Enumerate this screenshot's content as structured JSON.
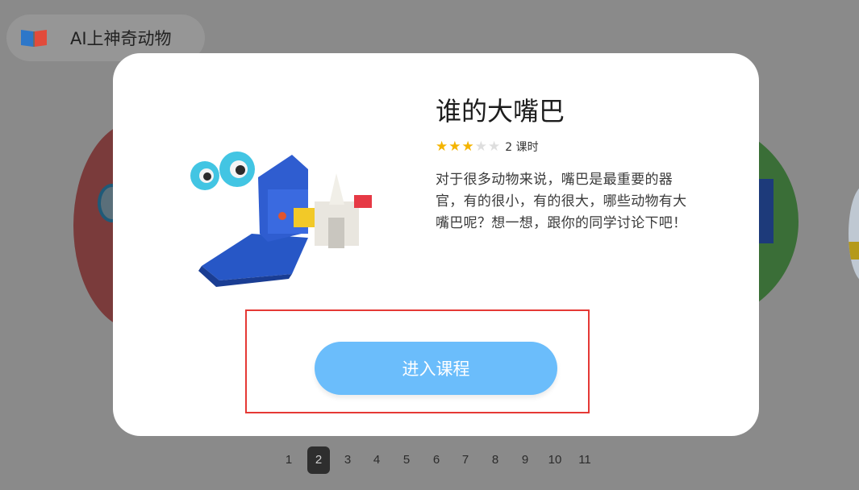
{
  "header": {
    "title": "AI上神奇动物",
    "icon": "open-book-icon"
  },
  "modal": {
    "title": "谁的大嘴巴",
    "rating": {
      "filled": 3,
      "total": 5,
      "star_color": "#f4b400",
      "empty_color": "#dedede"
    },
    "lesson_count": "2 课时",
    "description": "对于很多动物来说，嘴巴是最重要的器官，有的很小，有的很大，哪些动物有大嘴巴呢？想一想，跟你的同学讨论下吧！",
    "enter_button_label": "进入课程",
    "button_color": "#6bbdfb",
    "highlight_color": "#e53935"
  },
  "pagination": {
    "pages": [
      "1",
      "2",
      "3",
      "4",
      "5",
      "6",
      "7",
      "8",
      "9",
      "10",
      "11"
    ],
    "active": "2"
  },
  "colors": {
    "overlay_background": "#8a8a8a",
    "modal_background": "#ffffff"
  }
}
